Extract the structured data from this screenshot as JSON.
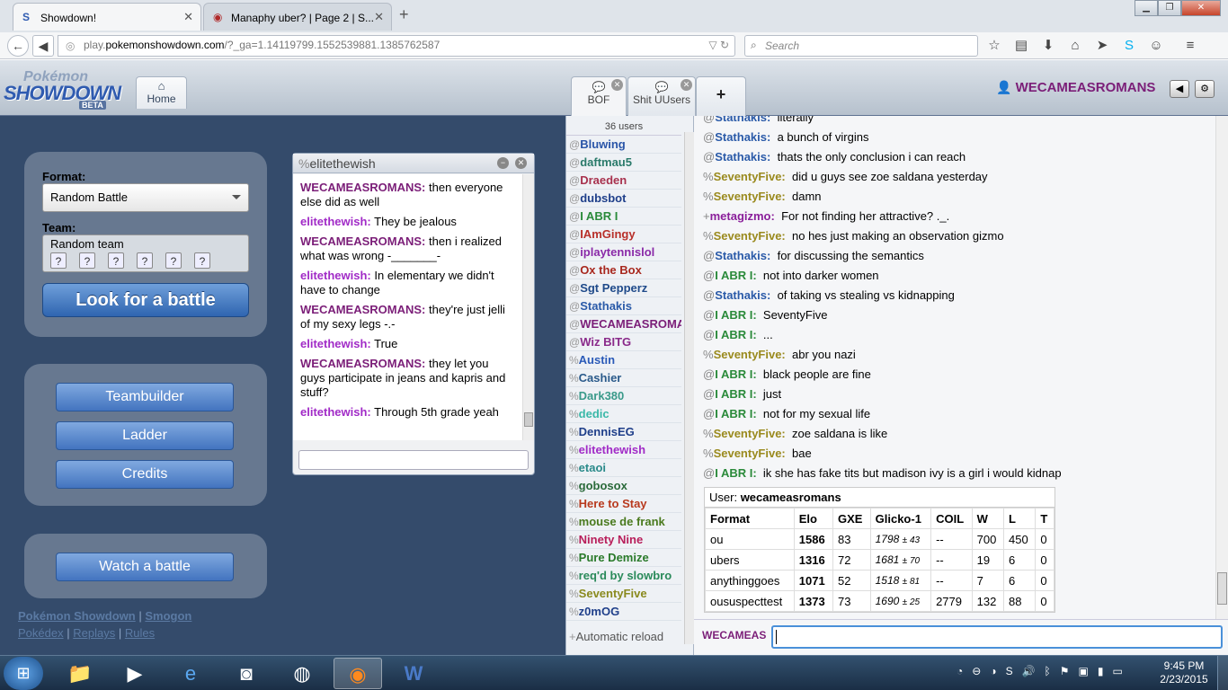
{
  "browser": {
    "tabs": [
      {
        "label": "Showdown!",
        "icon": "S"
      },
      {
        "label": "Manaphy uber? | Page 2 | S...",
        "icon": "smogon-icon"
      }
    ],
    "url_prefix": "play.",
    "url_domain": "pokemonshowdown.com",
    "url_rest": "/?_ga=1.14119799.1552539881.1385762587",
    "search_placeholder": "Search"
  },
  "header": {
    "logo_line1": "Pokémon",
    "logo_line2": "SHOWDOWN",
    "logo_badge": "BETA",
    "home_tab": "Home",
    "room_tabs": [
      {
        "label": "BOF"
      },
      {
        "label": "Shit UUsers"
      }
    ],
    "plus": "+",
    "username": "WECAMEASROMANS"
  },
  "main_menu": {
    "format_label": "Format:",
    "format_value": "Random Battle",
    "team_label": "Team:",
    "team_value": "Random team",
    "look_button": "Look for a battle",
    "teambuilder": "Teambuilder",
    "ladder": "Ladder",
    "credits": "Credits",
    "watch": "Watch a battle",
    "footer": {
      "ps": "Pokémon Showdown",
      "smogon": "Smogon",
      "pokedex": "Pokédex",
      "replays": "Replays",
      "rules": "Rules",
      "sep": "|"
    }
  },
  "pm": {
    "rank": "%",
    "name": "elitethewish",
    "messages": [
      {
        "user": "WECAMEASROMANS:",
        "text": "then everyone else did as well",
        "color": "#7b1e78"
      },
      {
        "user": "elitethewish:",
        "text": "They be jealous",
        "color": "#a12bc7"
      },
      {
        "user": "WECAMEASROMANS:",
        "text": "then i realized what was wrong -_______-",
        "color": "#7b1e78"
      },
      {
        "user": "elitethewish:",
        "text": "In elementary we didn't have to change",
        "color": "#a12bc7"
      },
      {
        "user": "WECAMEASROMANS:",
        "text": "they're just jelli of my sexy legs -.-",
        "color": "#7b1e78"
      },
      {
        "user": "elitethewish:",
        "text": "True",
        "color": "#a12bc7"
      },
      {
        "user": "WECAMEASROMANS:",
        "text": "they let you guys participate in jeans and kapris and stuff?",
        "color": "#7b1e78"
      },
      {
        "user": "elitethewish:",
        "text": "Through 5th grade yeah",
        "color": "#a12bc7"
      }
    ]
  },
  "userlist": {
    "count": "36 users",
    "users": [
      {
        "rank": "@",
        "name": "Bluwing",
        "color": "#2a55a8"
      },
      {
        "rank": "@",
        "name": "daftmau5",
        "color": "#2a7a6a"
      },
      {
        "rank": "@",
        "name": "Draeden",
        "color": "#a8324e"
      },
      {
        "rank": "@",
        "name": "dubsbot",
        "color": "#1f3f8a"
      },
      {
        "rank": "@",
        "name": "I ABR I",
        "color": "#2a8a3a"
      },
      {
        "rank": "@",
        "name": "IAmGingy",
        "color": "#b8302a"
      },
      {
        "rank": "@",
        "name": "iplaytennislol",
        "color": "#8a2aa8"
      },
      {
        "rank": "@",
        "name": "Ox the Box",
        "color": "#a8281e"
      },
      {
        "rank": "@",
        "name": "Sgt Pepperz",
        "color": "#1f4a8a"
      },
      {
        "rank": "@",
        "name": "Stathakis",
        "color": "#2a5aa8"
      },
      {
        "rank": "@",
        "name": "WECAMEASROMANS",
        "color": "#7b1e78"
      },
      {
        "rank": "@",
        "name": "Wiz BITG",
        "color": "#8a2a8a"
      },
      {
        "rank": "%",
        "name": "Austin",
        "color": "#2a5ab8"
      },
      {
        "rank": "%",
        "name": "Cashier",
        "color": "#2a5a8a"
      },
      {
        "rank": "%",
        "name": "Dark380",
        "color": "#3a9a8a"
      },
      {
        "rank": "%",
        "name": "dedic",
        "color": "#3ab8a8"
      },
      {
        "rank": "%",
        "name": "DennisEG",
        "color": "#1f3f8a"
      },
      {
        "rank": "%",
        "name": "elitethewish",
        "color": "#a12bc7"
      },
      {
        "rank": "%",
        "name": "etaoi",
        "color": "#2a8a8a"
      },
      {
        "rank": "%",
        "name": "gobosox",
        "color": "#2a6a3a"
      },
      {
        "rank": "%",
        "name": "Here to Stay",
        "color": "#b83a1e"
      },
      {
        "rank": "%",
        "name": "mouse de frank",
        "color": "#4a7a1e"
      },
      {
        "rank": "%",
        "name": "Ninety Nine",
        "color": "#b81e5a"
      },
      {
        "rank": "%",
        "name": "Pure Demize",
        "color": "#2a7a2a"
      },
      {
        "rank": "%",
        "name": "req'd by slowbro",
        "color": "#2a8a5a"
      },
      {
        "rank": "%",
        "name": "SeventyFive",
        "color": "#8a8a1e"
      },
      {
        "rank": "%",
        "name": "z0mOG",
        "color": "#1f3f8a"
      }
    ],
    "bottom": "Automatic reload",
    "bottom_prefix": "+"
  },
  "chat": {
    "lines": [
      {
        "rank": "@",
        "user": "Stathakis:",
        "text": "literally",
        "color": "#2a5aa8"
      },
      {
        "rank": "@",
        "user": "Stathakis:",
        "text": "a bunch of virgins",
        "color": "#2a5aa8"
      },
      {
        "rank": "@",
        "user": "Stathakis:",
        "text": "thats the only conclusion i can reach",
        "color": "#2a5aa8"
      },
      {
        "rank": "%",
        "user": "SeventyFive:",
        "text": "did u guys see zoe saldana yesterday",
        "color": "#9a8a1e"
      },
      {
        "rank": "%",
        "user": "SeventyFive:",
        "text": "damn",
        "color": "#9a8a1e"
      },
      {
        "rank": "+",
        "user": "metagizmo:",
        "text": "For not finding her attractive? ._.",
        "color": "#8a1e9a"
      },
      {
        "rank": "%",
        "user": "SeventyFive:",
        "text": "no hes just making an observation gizmo",
        "color": "#9a8a1e"
      },
      {
        "rank": "@",
        "user": "Stathakis:",
        "text": "for discussing the semantics",
        "color": "#2a5aa8"
      },
      {
        "rank": "@",
        "user": "I ABR I:",
        "text": "not into darker women",
        "color": "#2a8a3a"
      },
      {
        "rank": "@",
        "user": "Stathakis:",
        "text": "of taking vs stealing vs kidnapping",
        "color": "#2a5aa8"
      },
      {
        "rank": "@",
        "user": "I ABR I:",
        "text": "SeventyFive",
        "color": "#2a8a3a"
      },
      {
        "rank": "@",
        "user": "I ABR I:",
        "text": "...",
        "color": "#2a8a3a"
      },
      {
        "rank": "%",
        "user": "SeventyFive:",
        "text": "abr you nazi",
        "color": "#9a8a1e"
      },
      {
        "rank": "@",
        "user": "I ABR I:",
        "text": "black people are fine",
        "color": "#2a8a3a"
      },
      {
        "rank": "@",
        "user": "I ABR I:",
        "text": "just",
        "color": "#2a8a3a"
      },
      {
        "rank": "@",
        "user": "I ABR I:",
        "text": "not for my sexual life",
        "color": "#2a8a3a"
      },
      {
        "rank": "%",
        "user": "SeventyFive:",
        "text": "zoe saldana is like",
        "color": "#9a8a1e"
      },
      {
        "rank": "%",
        "user": "SeventyFive:",
        "text": "bae",
        "color": "#9a8a1e"
      },
      {
        "rank": "@",
        "user": "I ABR I:",
        "text": "ik she has fake tits but madison ivy is a girl i would kidnap",
        "color": "#2a8a3a"
      }
    ],
    "user_table": {
      "label": "User:",
      "user": "wecameasromans",
      "headers": [
        "Format",
        "Elo",
        "GXE",
        "Glicko-1",
        "COIL",
        "W",
        "L",
        "T"
      ],
      "rows": [
        {
          "format": "ou",
          "elo": "1586",
          "gxe": "83",
          "glicko": "1798",
          "glicko_dev": "± 43",
          "coil": "--",
          "w": "700",
          "l": "450",
          "t": "0"
        },
        {
          "format": "ubers",
          "elo": "1316",
          "gxe": "72",
          "glicko": "1681",
          "glicko_dev": "± 70",
          "coil": "--",
          "w": "19",
          "l": "6",
          "t": "0"
        },
        {
          "format": "anythinggoes",
          "elo": "1071",
          "gxe": "52",
          "glicko": "1518",
          "glicko_dev": "± 81",
          "coil": "--",
          "w": "7",
          "l": "6",
          "t": "0"
        },
        {
          "format": "oususpecttest",
          "elo": "1373",
          "gxe": "73",
          "glicko": "1690",
          "glicko_dev": "± 25",
          "coil": "2779",
          "w": "132",
          "l": "88",
          "t": "0"
        }
      ]
    },
    "input_name": "WECAMEAS"
  },
  "taskbar": {
    "time": "9:45 PM",
    "date": "2/23/2015"
  }
}
